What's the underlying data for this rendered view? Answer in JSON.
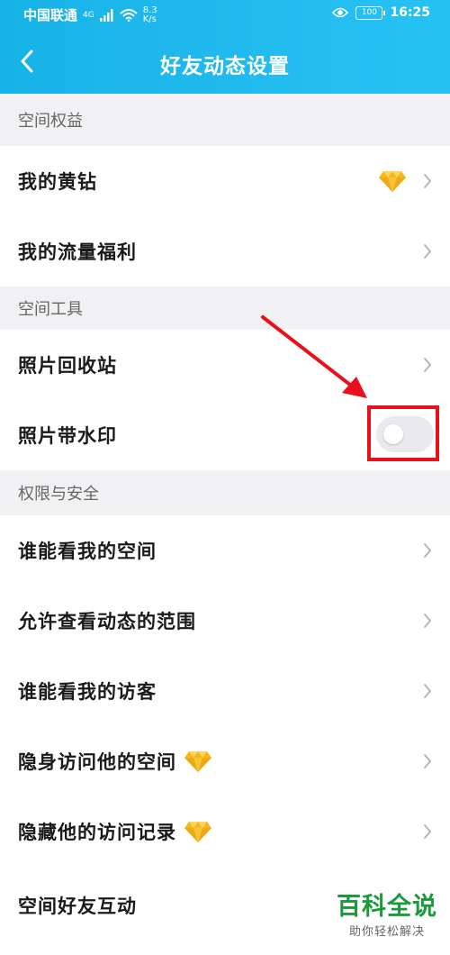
{
  "status_bar": {
    "carrier": "中国联通",
    "network": "4G",
    "speed_value": "8.3",
    "speed_unit": "K/s",
    "battery": "100",
    "time": "16:25"
  },
  "nav": {
    "title": "好友动态设置"
  },
  "sections": [
    {
      "header": "空间权益",
      "rows": [
        {
          "label": "我的黄钻"
        },
        {
          "label": "我的流量福利"
        }
      ]
    },
    {
      "header": "空间工具",
      "rows": [
        {
          "label": "照片回收站"
        },
        {
          "label": "照片带水印"
        }
      ]
    },
    {
      "header": "权限与安全",
      "rows": [
        {
          "label": "谁能看我的空间"
        },
        {
          "label": "允许查看动态的范围"
        },
        {
          "label": "谁能看我的访客"
        },
        {
          "label": "隐身访问他的空间"
        },
        {
          "label": "隐藏他的访问记录"
        },
        {
          "label": "空间好友互动"
        }
      ]
    }
  ],
  "toggle": {
    "watermark_enabled": false
  },
  "watermark": {
    "title": "百科全说",
    "subtitle": "助你轻松解决"
  },
  "colors": {
    "header": "#1fb8ec",
    "highlight": "#e8101a",
    "diamond": "#f5b81f",
    "watermark_green": "#1a9a3a"
  }
}
